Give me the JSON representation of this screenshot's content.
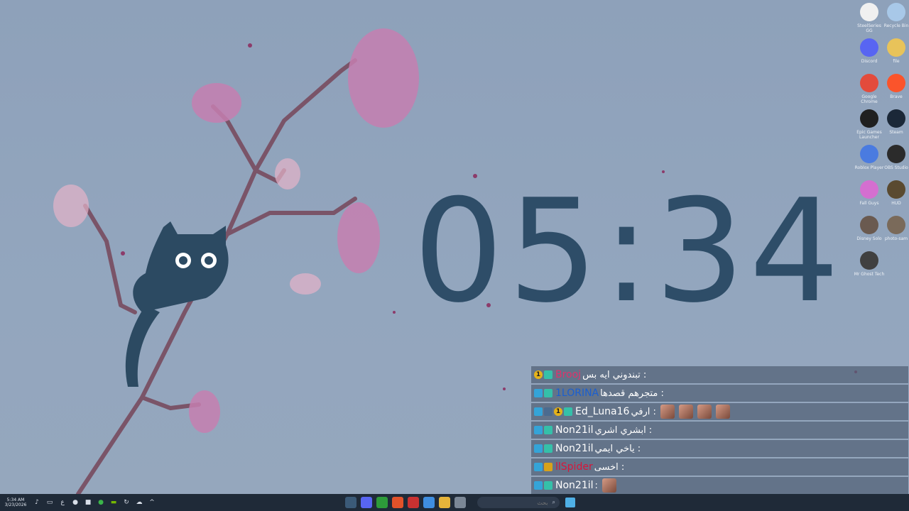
{
  "clock": {
    "time": "05:34"
  },
  "desktop_icons": [
    {
      "id": "steelseries",
      "label": "SteelSeries GG",
      "icon": "gear-icon",
      "color": "#f0f0f0"
    },
    {
      "id": "recycle",
      "label": "Recycle Bin",
      "icon": "recycle-bin-icon",
      "color": "#a8c8e8"
    },
    {
      "id": "discord",
      "label": "Discord",
      "icon": "discord-icon",
      "color": "#5865f2"
    },
    {
      "id": "folder",
      "label": "file",
      "icon": "folder-icon",
      "color": "#e8c35a"
    },
    {
      "id": "chrome",
      "label": "Google Chrome",
      "icon": "chrome-icon",
      "color": "#e34b3c"
    },
    {
      "id": "brave",
      "label": "Brave",
      "icon": "brave-icon",
      "color": "#fb542b"
    },
    {
      "id": "epic",
      "label": "Epic Games Launcher",
      "icon": "epic-games-icon",
      "color": "#202020"
    },
    {
      "id": "steam",
      "label": "Steam",
      "icon": "steam-icon",
      "color": "#1b2838"
    },
    {
      "id": "roblox",
      "label": "Roblox Player",
      "icon": "roblox-icon",
      "color": "#4a7be0"
    },
    {
      "id": "obs",
      "label": "OBS Studio",
      "icon": "obs-icon",
      "color": "#2b2b2b"
    },
    {
      "id": "fallguys",
      "label": "Fall Guys",
      "icon": "fall-guys-icon",
      "color": "#d46fd0"
    },
    {
      "id": "hud",
      "label": "HUD",
      "icon": "image-icon",
      "color": "#5a4a30"
    },
    {
      "id": "photo1",
      "label": "Disney Solo",
      "icon": "image-icon",
      "color": "#6a5a50"
    },
    {
      "id": "photo2",
      "label": "photo-sam",
      "icon": "image-icon",
      "color": "#7a6a5a"
    },
    {
      "id": "photo3",
      "label": "Mr Ghost Tech",
      "icon": "image-icon",
      "color": "#404040"
    }
  ],
  "chat": {
    "messages": [
      {
        "badges": [
          "b-num",
          "b-kick"
        ],
        "badge_text": [
          "1",
          ""
        ],
        "user": "Brooj",
        "user_color": "#e0336b",
        "text": ": تبندوني ايه بس",
        "emotes": 0
      },
      {
        "badges": [
          "b-game",
          "b-kick"
        ],
        "badge_text": [
          "",
          ""
        ],
        "user": "1LORINA",
        "user_color": "#1a5fd0",
        "text": ": متجرهم قصدها",
        "emotes": 0
      },
      {
        "badges": [
          "b-game",
          "b-mod",
          "b-num",
          "b-kick"
        ],
        "badge_text": [
          "",
          "",
          "1",
          ""
        ],
        "user": "Ed_Luna16",
        "user_color": "#ffffff",
        "text": ": ارفي",
        "emotes": 4
      },
      {
        "badges": [
          "b-game",
          "b-kick"
        ],
        "badge_text": [
          "",
          ""
        ],
        "user": "Non21il",
        "user_color": "#ffffff",
        "text": ": ابشري اشري",
        "emotes": 0
      },
      {
        "badges": [
          "b-game",
          "b-kick"
        ],
        "badge_text": [
          "",
          ""
        ],
        "user": "Non21il",
        "user_color": "#ffffff",
        "text": ": ياخي ايمي",
        "emotes": 0
      },
      {
        "badges": [
          "b-game",
          "b-crown"
        ],
        "badge_text": [
          "",
          ""
        ],
        "user": "llSpider",
        "user_color": "#d8163a",
        "text": ": اخسى",
        "emotes": 0
      },
      {
        "badges": [
          "b-game",
          "b-kick"
        ],
        "badge_text": [
          "",
          ""
        ],
        "user": "Non21il",
        "user_color": "#ffffff",
        "text": ":",
        "emotes": 1
      }
    ]
  },
  "taskbar": {
    "time": "5:34 AM",
    "date": "3/23/2026",
    "lang": "ع",
    "search_placeholder": "بحث",
    "apps": [
      {
        "id": "steam",
        "icon": "steam-icon",
        "glyph": "S",
        "color": "#3b5a78"
      },
      {
        "id": "discord",
        "icon": "discord-icon",
        "glyph": "D",
        "color": "#5865f2"
      },
      {
        "id": "xbox",
        "icon": "xbox-icon",
        "glyph": "X",
        "color": "#2d9b3a"
      },
      {
        "id": "brave",
        "icon": "brave-icon",
        "glyph": "B",
        "color": "#e2522a"
      },
      {
        "id": "roblox-studio",
        "icon": "roblox-studio-icon",
        "glyph": "R",
        "color": "#c93131"
      },
      {
        "id": "chrome",
        "icon": "chrome-icon",
        "glyph": "C",
        "color": "#3f8ee0"
      },
      {
        "id": "explorer",
        "icon": "folder-icon",
        "glyph": "F",
        "color": "#e6b43a"
      },
      {
        "id": "monitor",
        "icon": "window-icon",
        "glyph": "W",
        "color": "#7b8796"
      }
    ]
  }
}
